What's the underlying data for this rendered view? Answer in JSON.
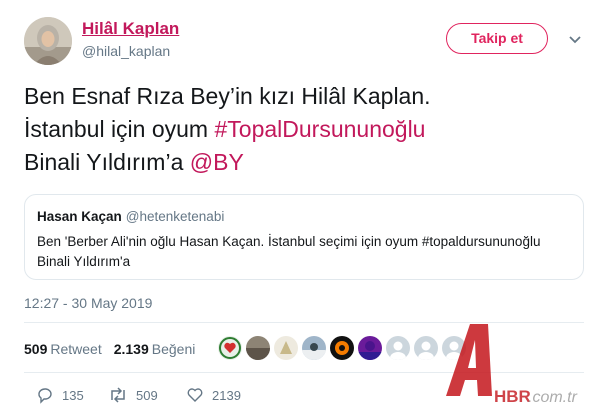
{
  "author": {
    "display_name": "Hilâl Kaplan",
    "handle": "@hilal_kaplan"
  },
  "follow_button_label": "Takip et",
  "tweet": {
    "line1": "Ben Esnaf Rıza Bey’in kızı Hilâl Kaplan.",
    "line2_prefix": "İstanbul için oyum ",
    "hashtag": "#TopalDursununoğlu",
    "line3_prefix": "Binali Yıldırım’a ",
    "mention": "@BY"
  },
  "quoted_tweet": {
    "name": "Hasan Kaçan",
    "handle": "@hetenketenabi",
    "text": "Ben 'Berber Ali'nin oğlu Hasan Kaçan. İstanbul seçimi için oyum #topaldursununoğlu Binali Yıldırım'a"
  },
  "timestamp": "12:27 - 30 May 2019",
  "stats": {
    "retweets_count": "509",
    "retweets_label": "Retweet",
    "likes_count": "2.139",
    "likes_label": "Beğeni"
  },
  "actions": {
    "replies": "135",
    "retweets": "509",
    "likes": "2139"
  },
  "watermark": {
    "brand": "HBR",
    "domain": ".com.tr"
  },
  "colors": {
    "accent": "#c2185b",
    "follow_border": "#e0245e",
    "secondary_text": "#657786",
    "watermark_red": "#c4161c"
  },
  "icons": [
    "chevron-down-icon",
    "reply-icon",
    "retweet-icon",
    "heart-icon"
  ]
}
